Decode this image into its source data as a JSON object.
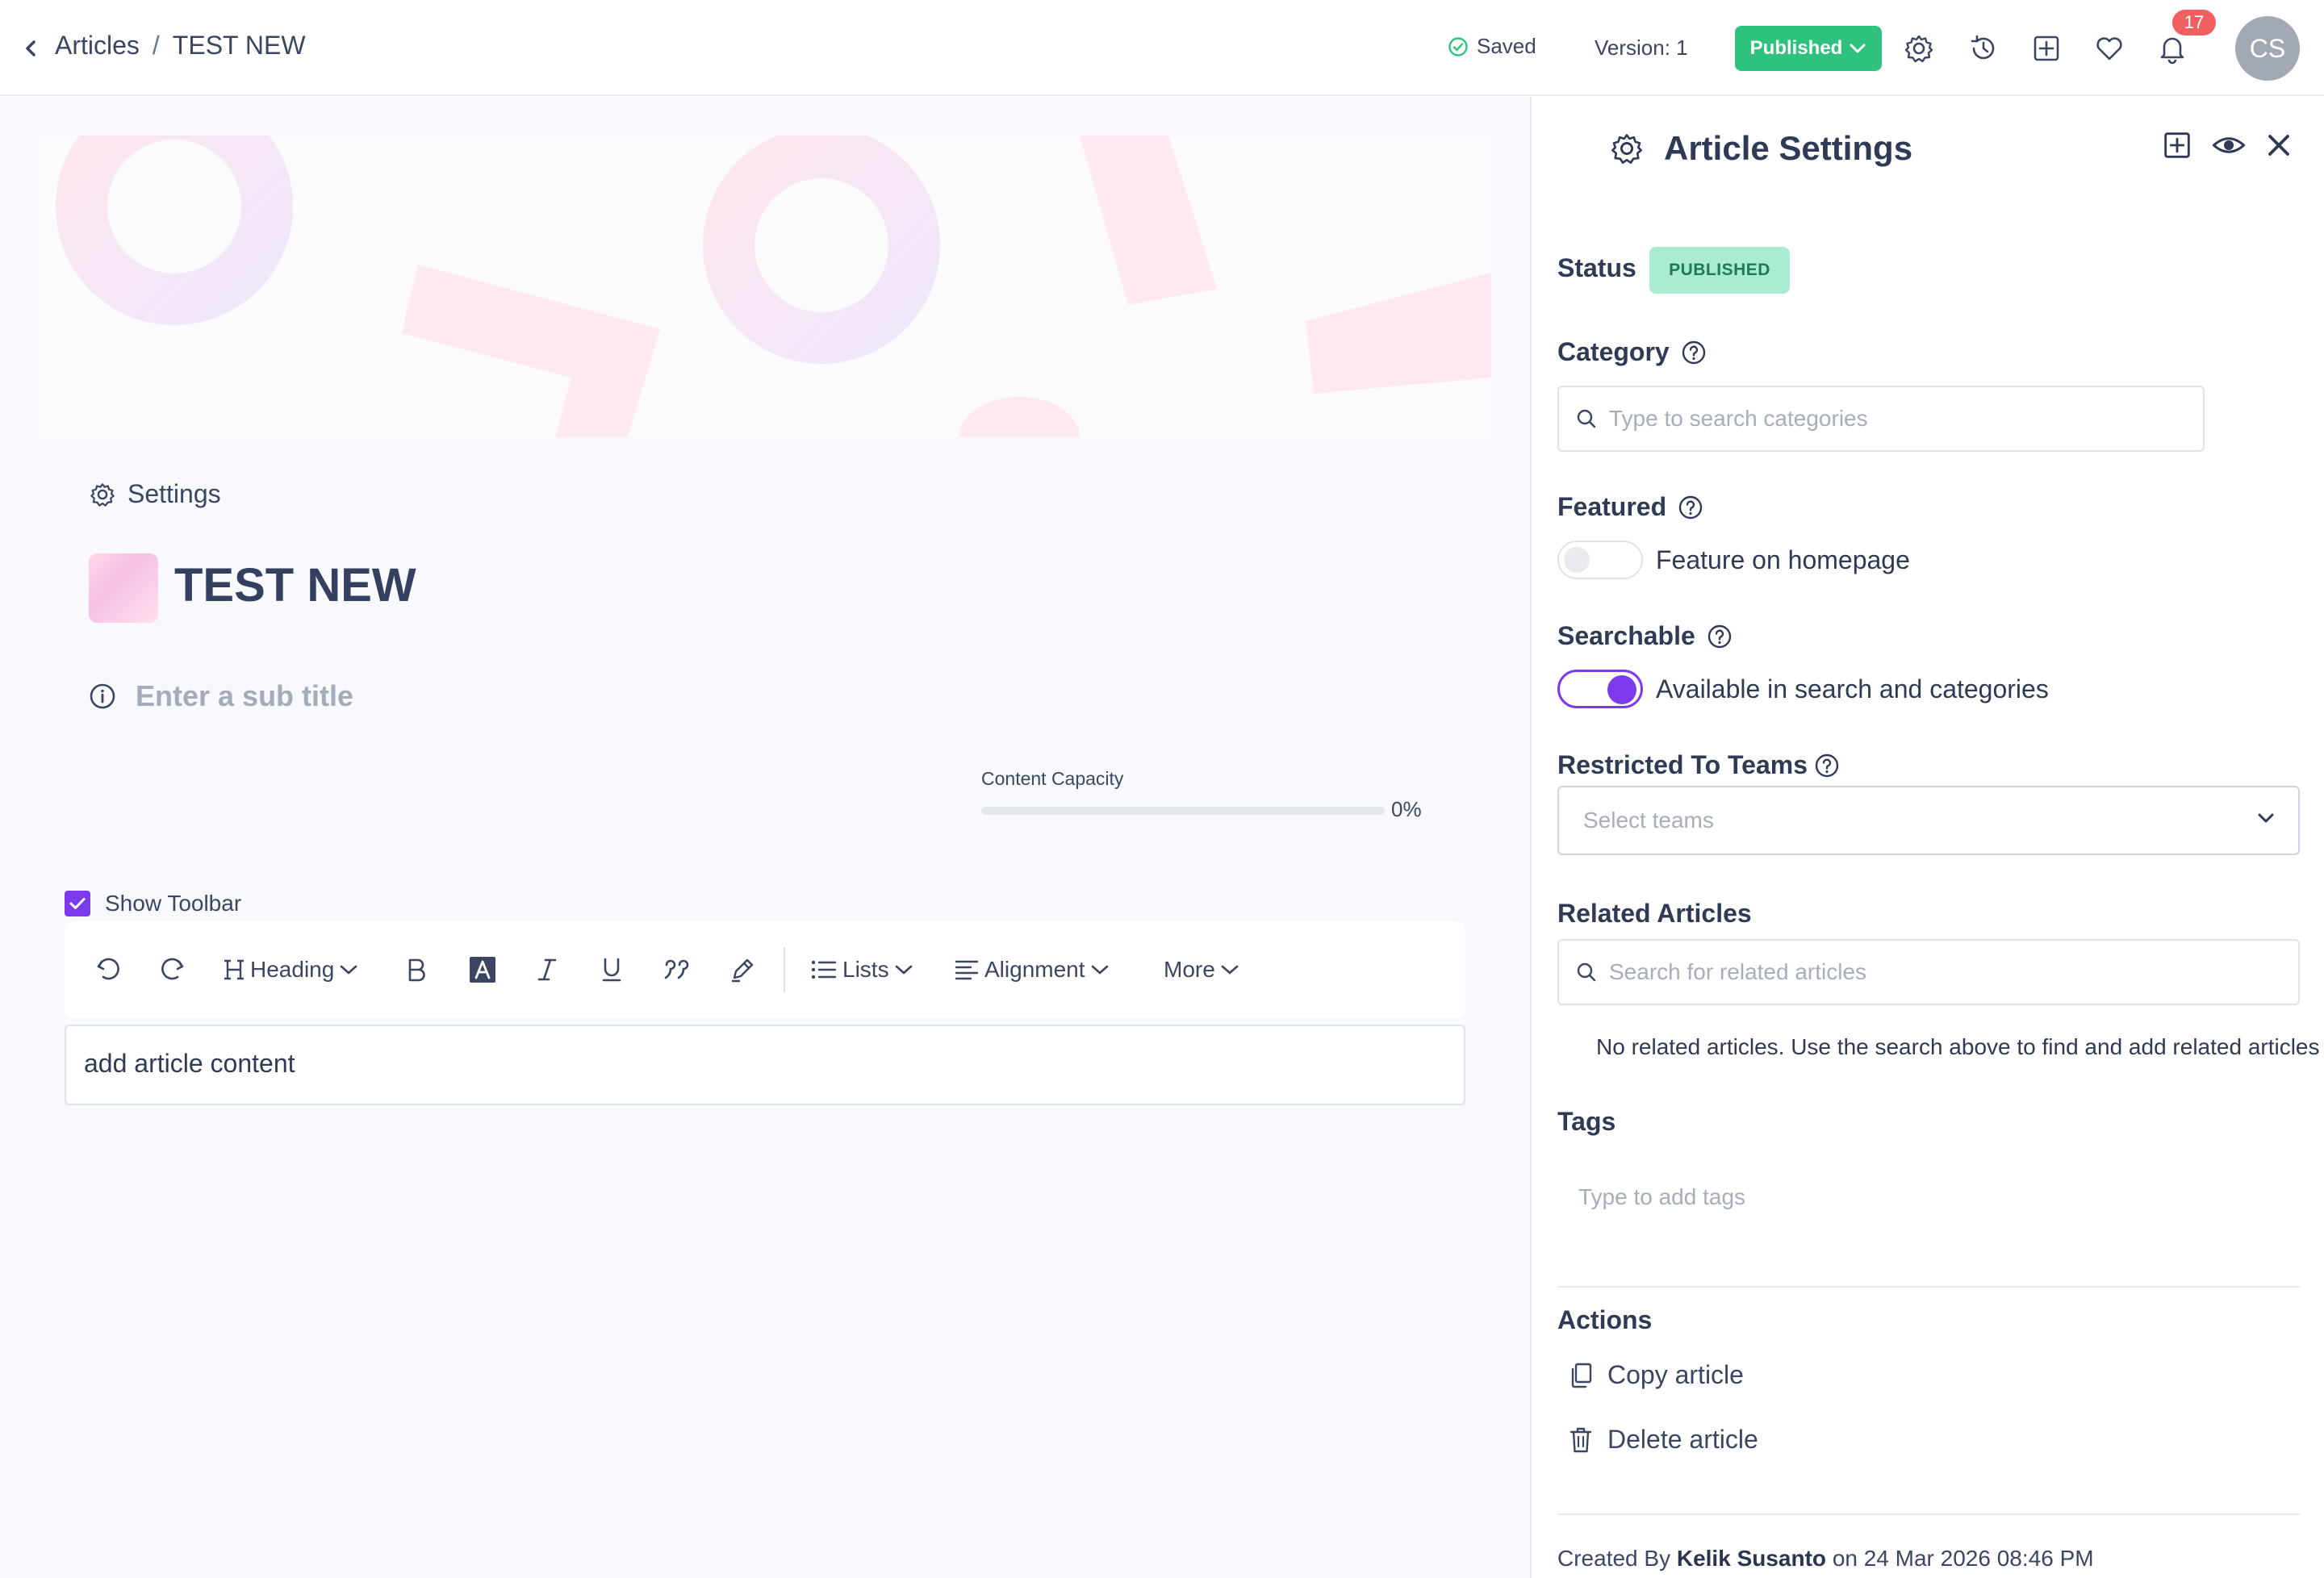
{
  "topbar": {
    "breadcrumb_root": "Articles",
    "breadcrumb_sep": "/",
    "breadcrumb_current": "TEST NEW",
    "saved_label": "Saved",
    "version_label": "Version: 1",
    "publish_label": "Published",
    "notification_count": "17",
    "avatar_initials": "CS",
    "icons": [
      "back-chevron-icon",
      "check-circle-icon",
      "chevron-down-icon",
      "gear-icon",
      "history-icon",
      "plus-square-icon",
      "heart-icon",
      "bell-icon"
    ]
  },
  "editor": {
    "settings_label": "Settings",
    "title": "TEST NEW",
    "subtitle_placeholder": "Enter a sub title",
    "show_toolbar_label": "Show Toolbar",
    "show_toolbar_checked": true,
    "capacity_label": "Content Capacity",
    "capacity_percent": 0,
    "capacity_text": "0%",
    "toolbar": {
      "heading_label": "Heading",
      "lists_label": "Lists",
      "alignment_label": "Alignment",
      "more_label": "More"
    },
    "content": "add article content"
  },
  "panel": {
    "title": "Article Settings",
    "status_label": "Status",
    "status_value": "PUBLISHED",
    "category_label": "Category",
    "category_placeholder": "Type to search categories",
    "featured_label": "Featured",
    "featured_toggle_label": "Feature on homepage",
    "featured_on": false,
    "searchable_label": "Searchable",
    "searchable_toggle_label": "Available in search and categories",
    "searchable_on": true,
    "teams_label": "Restricted To Teams",
    "teams_placeholder": "Select teams",
    "related_label": "Related Articles",
    "related_placeholder": "Search for related articles",
    "related_empty": "No related articles. Use the search above to find and add related articles",
    "tags_label": "Tags",
    "tags_placeholder": "Type to add tags",
    "actions_label": "Actions",
    "copy_label": "Copy article",
    "delete_label": "Delete article",
    "created_prefix": "Created By",
    "created_by": "Kelik Susanto",
    "created_on": "on 24 Mar 2026 08:46 PM"
  },
  "colors": {
    "accent": "#7c3aed",
    "publish": "#2ec27e",
    "status_bg": "#a9ecd1",
    "badge": "#f06060"
  }
}
